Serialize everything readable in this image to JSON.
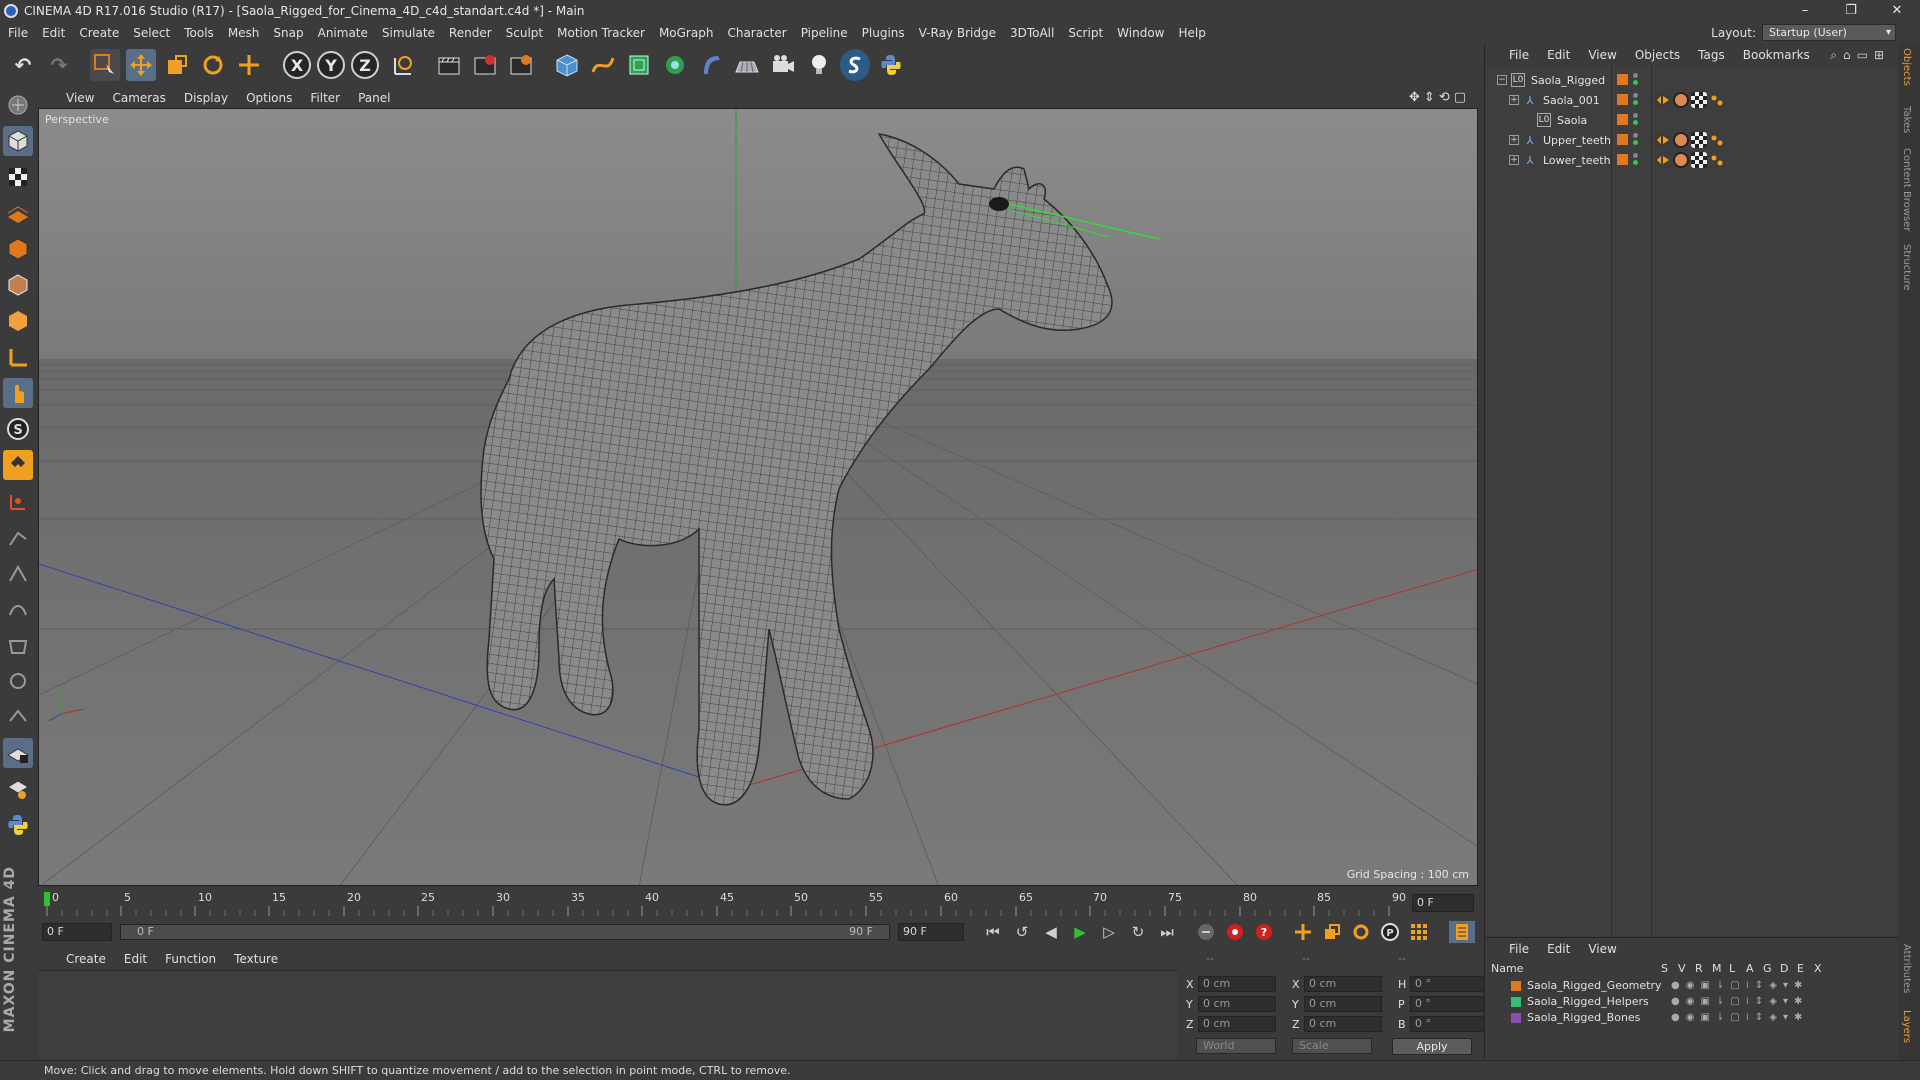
{
  "window": {
    "title": "CINEMA 4D R17.016 Studio (R17) - [Saola_Rigged_for_Cinema_4D_c4d_standart.c4d *] - Main",
    "minimize": "–",
    "maximize": "❐",
    "close": "✕"
  },
  "menubar": {
    "items": [
      "File",
      "Edit",
      "Create",
      "Select",
      "Tools",
      "Mesh",
      "Snap",
      "Animate",
      "Simulate",
      "Render",
      "Sculpt",
      "Motion Tracker",
      "MoGraph",
      "Character",
      "Pipeline",
      "Plugins",
      "V-Ray Bridge",
      "3DToAll",
      "Script",
      "Window",
      "Help"
    ]
  },
  "layout": {
    "label": "Layout:",
    "value": "Startup (User)"
  },
  "toolbar": {
    "axis_x": "X",
    "axis_y": "Y",
    "axis_z": "Z"
  },
  "viewport": {
    "menu": [
      "View",
      "Cameras",
      "Display",
      "Options",
      "Filter",
      "Panel"
    ],
    "camera_label": "Perspective",
    "grid_spacing": "Grid Spacing : 100 cm"
  },
  "timeline": {
    "ticks": [
      "0",
      "5",
      "10",
      "15",
      "20",
      "25",
      "30",
      "35",
      "40",
      "45",
      "50",
      "55",
      "60",
      "65",
      "70",
      "75",
      "80",
      "85",
      "90"
    ],
    "current_frame": "0 F",
    "start_field": "0 F",
    "range_start": "0 F",
    "range_end": "90 F",
    "end_field": "90 F"
  },
  "material_manager": {
    "menu": [
      "Create",
      "Edit",
      "Function",
      "Texture"
    ]
  },
  "coordinates": {
    "header_dashes": [
      "--",
      "--",
      "--"
    ],
    "rows": [
      {
        "a1": "X",
        "v1": "0 cm",
        "a2": "X",
        "v2": "0 cm",
        "a3": "H",
        "v3": "0 °"
      },
      {
        "a1": "Y",
        "v1": "0 cm",
        "a2": "Y",
        "v2": "0 cm",
        "a3": "P",
        "v3": "0 °"
      },
      {
        "a1": "Z",
        "v1": "0 cm",
        "a2": "Z",
        "v2": "0 cm",
        "a3": "B",
        "v3": "0 °"
      }
    ],
    "mode": "World",
    "transform": "Scale",
    "apply": "Apply"
  },
  "object_manager": {
    "menu": [
      "File",
      "Edit",
      "View",
      "Objects",
      "Tags",
      "Bookmarks"
    ],
    "objects": [
      {
        "name": "Saola_Rigged",
        "expander": "−",
        "icon": "null-object-icon",
        "glyph": "L0"
      },
      {
        "name": "Saola_001",
        "expander": "+",
        "icon": "bone-icon",
        "glyph": "⅄"
      },
      {
        "name": "Saola",
        "expander": "",
        "icon": "null-object-icon",
        "glyph": "L0"
      },
      {
        "name": "Upper_teeth",
        "expander": "+",
        "icon": "bone-icon",
        "glyph": "⅄"
      },
      {
        "name": "Lower_teeth",
        "expander": "+",
        "icon": "bone-icon",
        "glyph": "⅄"
      }
    ]
  },
  "layer_manager": {
    "menu": [
      "File",
      "Edit",
      "View"
    ],
    "columns": [
      "Name",
      "S",
      "V",
      "R",
      "M",
      "L",
      "A",
      "G",
      "D",
      "E",
      "X"
    ],
    "layers": [
      {
        "name": "Saola_Rigged_Geometry",
        "color": "#e07820"
      },
      {
        "name": "Saola_Rigged_Helpers",
        "color": "#30c070"
      },
      {
        "name": "Saola_Rigged_Bones",
        "color": "#8a4fb0"
      }
    ]
  },
  "side_tabs": [
    "Objects",
    "Takes",
    "Content Browser",
    "Structure",
    "Attributes",
    "Layers"
  ],
  "status": "Move: Click and drag to move elements. Hold down SHIFT to quantize movement / add to the selection in point mode, CTRL to remove.",
  "brand": "MAXON CINEMA 4D",
  "colors": {
    "accent": "#e07820",
    "axis_x": "#c03030",
    "axis_y": "#30b030",
    "axis_z": "#3040c0"
  }
}
